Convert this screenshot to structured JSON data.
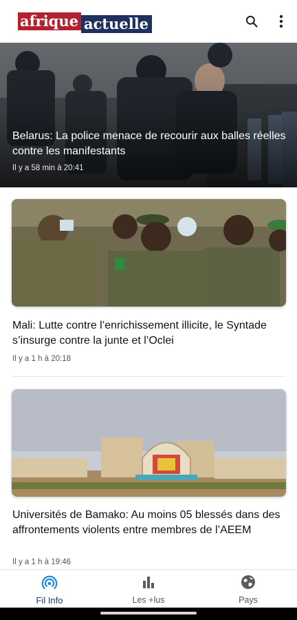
{
  "app": {
    "logo_part1": "afrique",
    "logo_part2": "actuelle"
  },
  "icons": {
    "search": "search-icon",
    "menu": "more-vert-icon",
    "fil_info": "broadcast-icon",
    "les_plus": "bar-chart-icon",
    "pays": "globe-icon"
  },
  "colors": {
    "brand_red": "#b32030",
    "brand_navy": "#1f2f5e",
    "active_tab": "#1a3a66"
  },
  "articles": [
    {
      "title": "Belarus: La police menace de recourir aux balles réelles contre les manifestants",
      "time": "Il y a 58 min à 20:41"
    },
    {
      "title": "Mali: Lutte contre l’enrichissement illicite, le Syntade s’insurge contre la junte et l’Oclei",
      "time": "Il y a 1 h à 20:18"
    },
    {
      "title": "Universités de Bamako: Au moins 05 blessés dans des affrontements violents entre membres de l’AEEM",
      "time": "Il y a 1 h à 19:46"
    }
  ],
  "nav": [
    {
      "label": "Fil Info",
      "active": true
    },
    {
      "label": "Les +lus",
      "active": false
    },
    {
      "label": "Pays",
      "active": false
    }
  ]
}
